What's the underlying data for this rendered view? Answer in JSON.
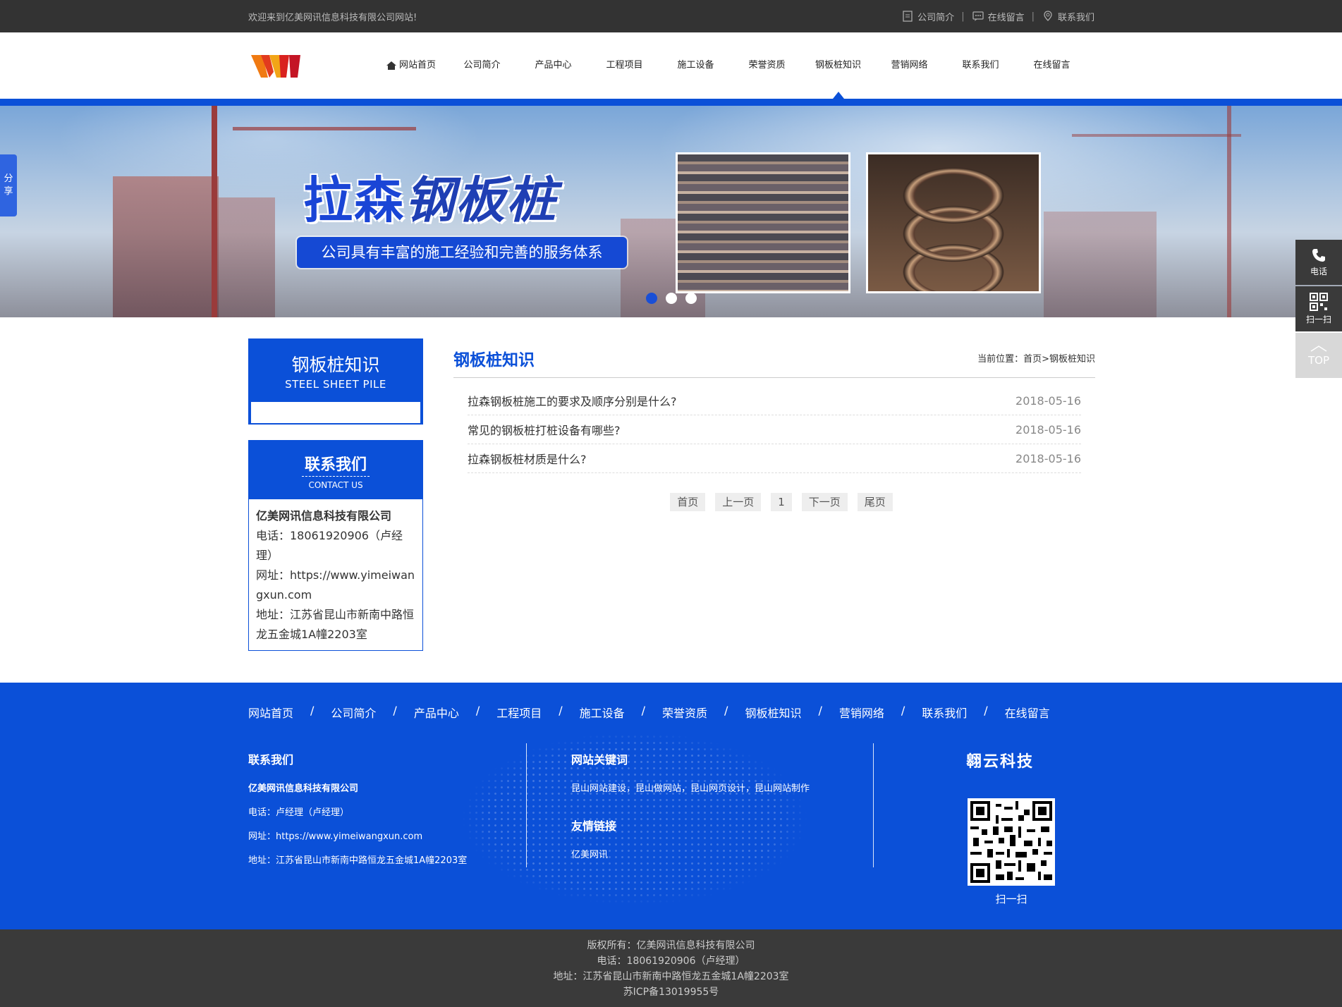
{
  "topbar": {
    "welcome": "欢迎来到亿美网讯信息科技有限公司网站!",
    "links": [
      "公司简介",
      "在线留言",
      "联系我们"
    ]
  },
  "nav": {
    "items": [
      "网站首页",
      "公司简介",
      "产品中心",
      "工程项目",
      "施工设备",
      "荣誉资质",
      "钢板桩知识",
      "营销网络",
      "联系我们",
      "在线留言"
    ],
    "active": "钢板桩知识"
  },
  "banner": {
    "title_a": "拉森",
    "title_b": "钢板桩",
    "subtitle": "公司具有丰富的施工经验和完善的服务体系",
    "slide_count": 3,
    "active_slide": 1
  },
  "side": {
    "share": [
      "分",
      "享"
    ],
    "phone": "电话",
    "scan": "扫一扫",
    "top": "TOP"
  },
  "left": {
    "title": "钢板桩知识",
    "title_en": "STEEL SHEET PILE",
    "contact_title": "联系我们",
    "contact_en": "CONTACT US",
    "company": "亿美网讯信息科技有限公司",
    "phone": "电话：18061920906（卢经理）",
    "url": "网址：https://www.yimeiwangxun.com",
    "address": "地址：江苏省昆山市新南中路恒龙五金城1A幢2203室"
  },
  "main": {
    "title": "钢板桩知识",
    "breadcrumb": "当前位置：首页>钢板桩知识",
    "articles": [
      {
        "title": "拉森钢板桩施工的要求及顺序分别是什么?",
        "date": "2018-05-16"
      },
      {
        "title": "常见的钢板桩打桩设备有哪些?",
        "date": "2018-05-16"
      },
      {
        "title": "拉森钢板桩材质是什么?",
        "date": "2018-05-16"
      }
    ],
    "pager": [
      "首页",
      "上一页",
      "1",
      "下一页",
      "尾页"
    ]
  },
  "footer": {
    "nav": [
      "网站首页",
      "公司简介",
      "产品中心",
      "工程项目",
      "施工设备",
      "荣誉资质",
      "钢板桩知识",
      "营销网络",
      "联系我们",
      "在线留言"
    ],
    "contact_title": "联系我们",
    "company": "亿美网讯信息科技有限公司",
    "phone": "电话：卢经理（卢经理）",
    "url": "网址：https://www.yimeiwangxun.com",
    "address": "地址：江苏省昆山市新南中路恒龙五金城1A幢2203室",
    "keywords_title": "网站关键词",
    "keywords": "昆山网站建设，昆山做网站，昆山网页设计，昆山网站制作",
    "friends_title": "友情链接",
    "friend": "亿美网讯",
    "brand": "翱云科技",
    "qr_label": "扫一扫"
  },
  "copyright": {
    "owner": "版权所有：亿美网讯信息科技有限公司",
    "phone": "电话：18061920906（卢经理）",
    "address": "地址：江苏省昆山市新南中路恒龙五金城1A幢2203室",
    "icp": "苏ICP备13019955号"
  },
  "colors": {
    "primary": "#0b50d8",
    "dark": "#333333"
  }
}
